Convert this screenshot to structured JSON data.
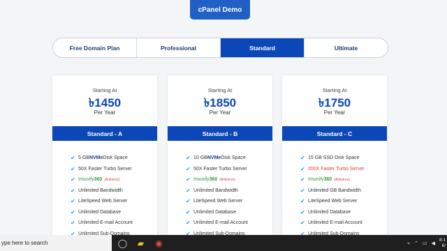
{
  "demo_button": "cPanel Demo",
  "tabs": [
    {
      "label": "Free Domain Plan",
      "active": false
    },
    {
      "label": "Professional",
      "active": false
    },
    {
      "label": "Standard",
      "active": true
    },
    {
      "label": "Ultimate",
      "active": false
    }
  ],
  "plans": [
    {
      "starting": "Starting At",
      "price": "৳1450",
      "period": "Per Year",
      "name": "Standard - A",
      "features": [
        {
          "pre": "5 GB ",
          "strong": "NVMe",
          "post": " Disk Space"
        },
        {
          "text": "50X Faster Turbo Server"
        },
        {
          "green": "Imunify ",
          "greenStrong": "360",
          "note": "(Antivirus)"
        },
        {
          "text": "Unlimited Bandwidth"
        },
        {
          "text": "LiteSpeed Web Server"
        },
        {
          "text": "Unlimited Database"
        },
        {
          "text": "Unlimited E-mail Account"
        },
        {
          "text": "Unlimited Sub-Domains"
        }
      ]
    },
    {
      "starting": "Starting At",
      "price": "৳1850",
      "period": "Per Year",
      "name": "Standard - B",
      "features": [
        {
          "pre": "10 GB ",
          "strong": "NVMe",
          "post": " Disk Space"
        },
        {
          "text": "50X Faster Turbo Server"
        },
        {
          "green": "Imunify ",
          "greenStrong": "360",
          "note": "(Antivirus)"
        },
        {
          "text": "Unlimited Bandwidth"
        },
        {
          "text": "LiteSpeed Web Server"
        },
        {
          "text": "Unlimited Database"
        },
        {
          "text": "Unlimited E-mail Account"
        },
        {
          "text": "Unlimited Sub-Domains"
        }
      ]
    },
    {
      "starting": "Starting At",
      "price": "৳1750",
      "period": "Per Year",
      "name": "Standard - C",
      "features": [
        {
          "text": "15 GB SSD Disk Space"
        },
        {
          "red": "200X Faster Turbo Server"
        },
        {
          "green": "Imunify ",
          "greenStrong": "360",
          "note": "(Antivirus)"
        },
        {
          "text": "Unlimited GB Bandwidth"
        },
        {
          "text": "LiteSpeed Web Server"
        },
        {
          "text": "Unlimited Database"
        },
        {
          "text": "Unlimited E-mail Account"
        },
        {
          "text": "Unlimited Sub-Domains"
        }
      ]
    }
  ],
  "taskbar": {
    "search_placeholder": "ype here to search",
    "time": "8:1",
    "date": "6/"
  }
}
